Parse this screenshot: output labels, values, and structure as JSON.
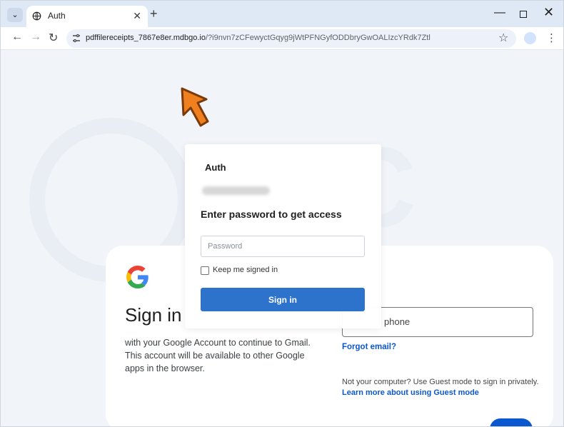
{
  "browser": {
    "tab_title": "Auth",
    "url_host": "pdffilereceipts_7867e8er.mdbgo.io",
    "url_path": "/?i9nvn7zCFewyctGqyg9jWtPFNGyfODDbryGwOALIzcYRdk7Ztl"
  },
  "google": {
    "title": "Sign in",
    "description": "with your Google Account to continue to Gmail. This account will be available to other Google apps in the browser.",
    "email_field_label": "phone",
    "forgot_email": "Forgot email?",
    "guest_note": "Not your computer? Use Guest mode to sign in privately.",
    "guest_link": "Learn more about using Guest mode"
  },
  "auth_modal": {
    "title": "Auth",
    "heading": "Enter password to get access",
    "password_placeholder": "Password",
    "keep_signed_in": "Keep me signed in",
    "sign_in_button": "Sign in"
  }
}
